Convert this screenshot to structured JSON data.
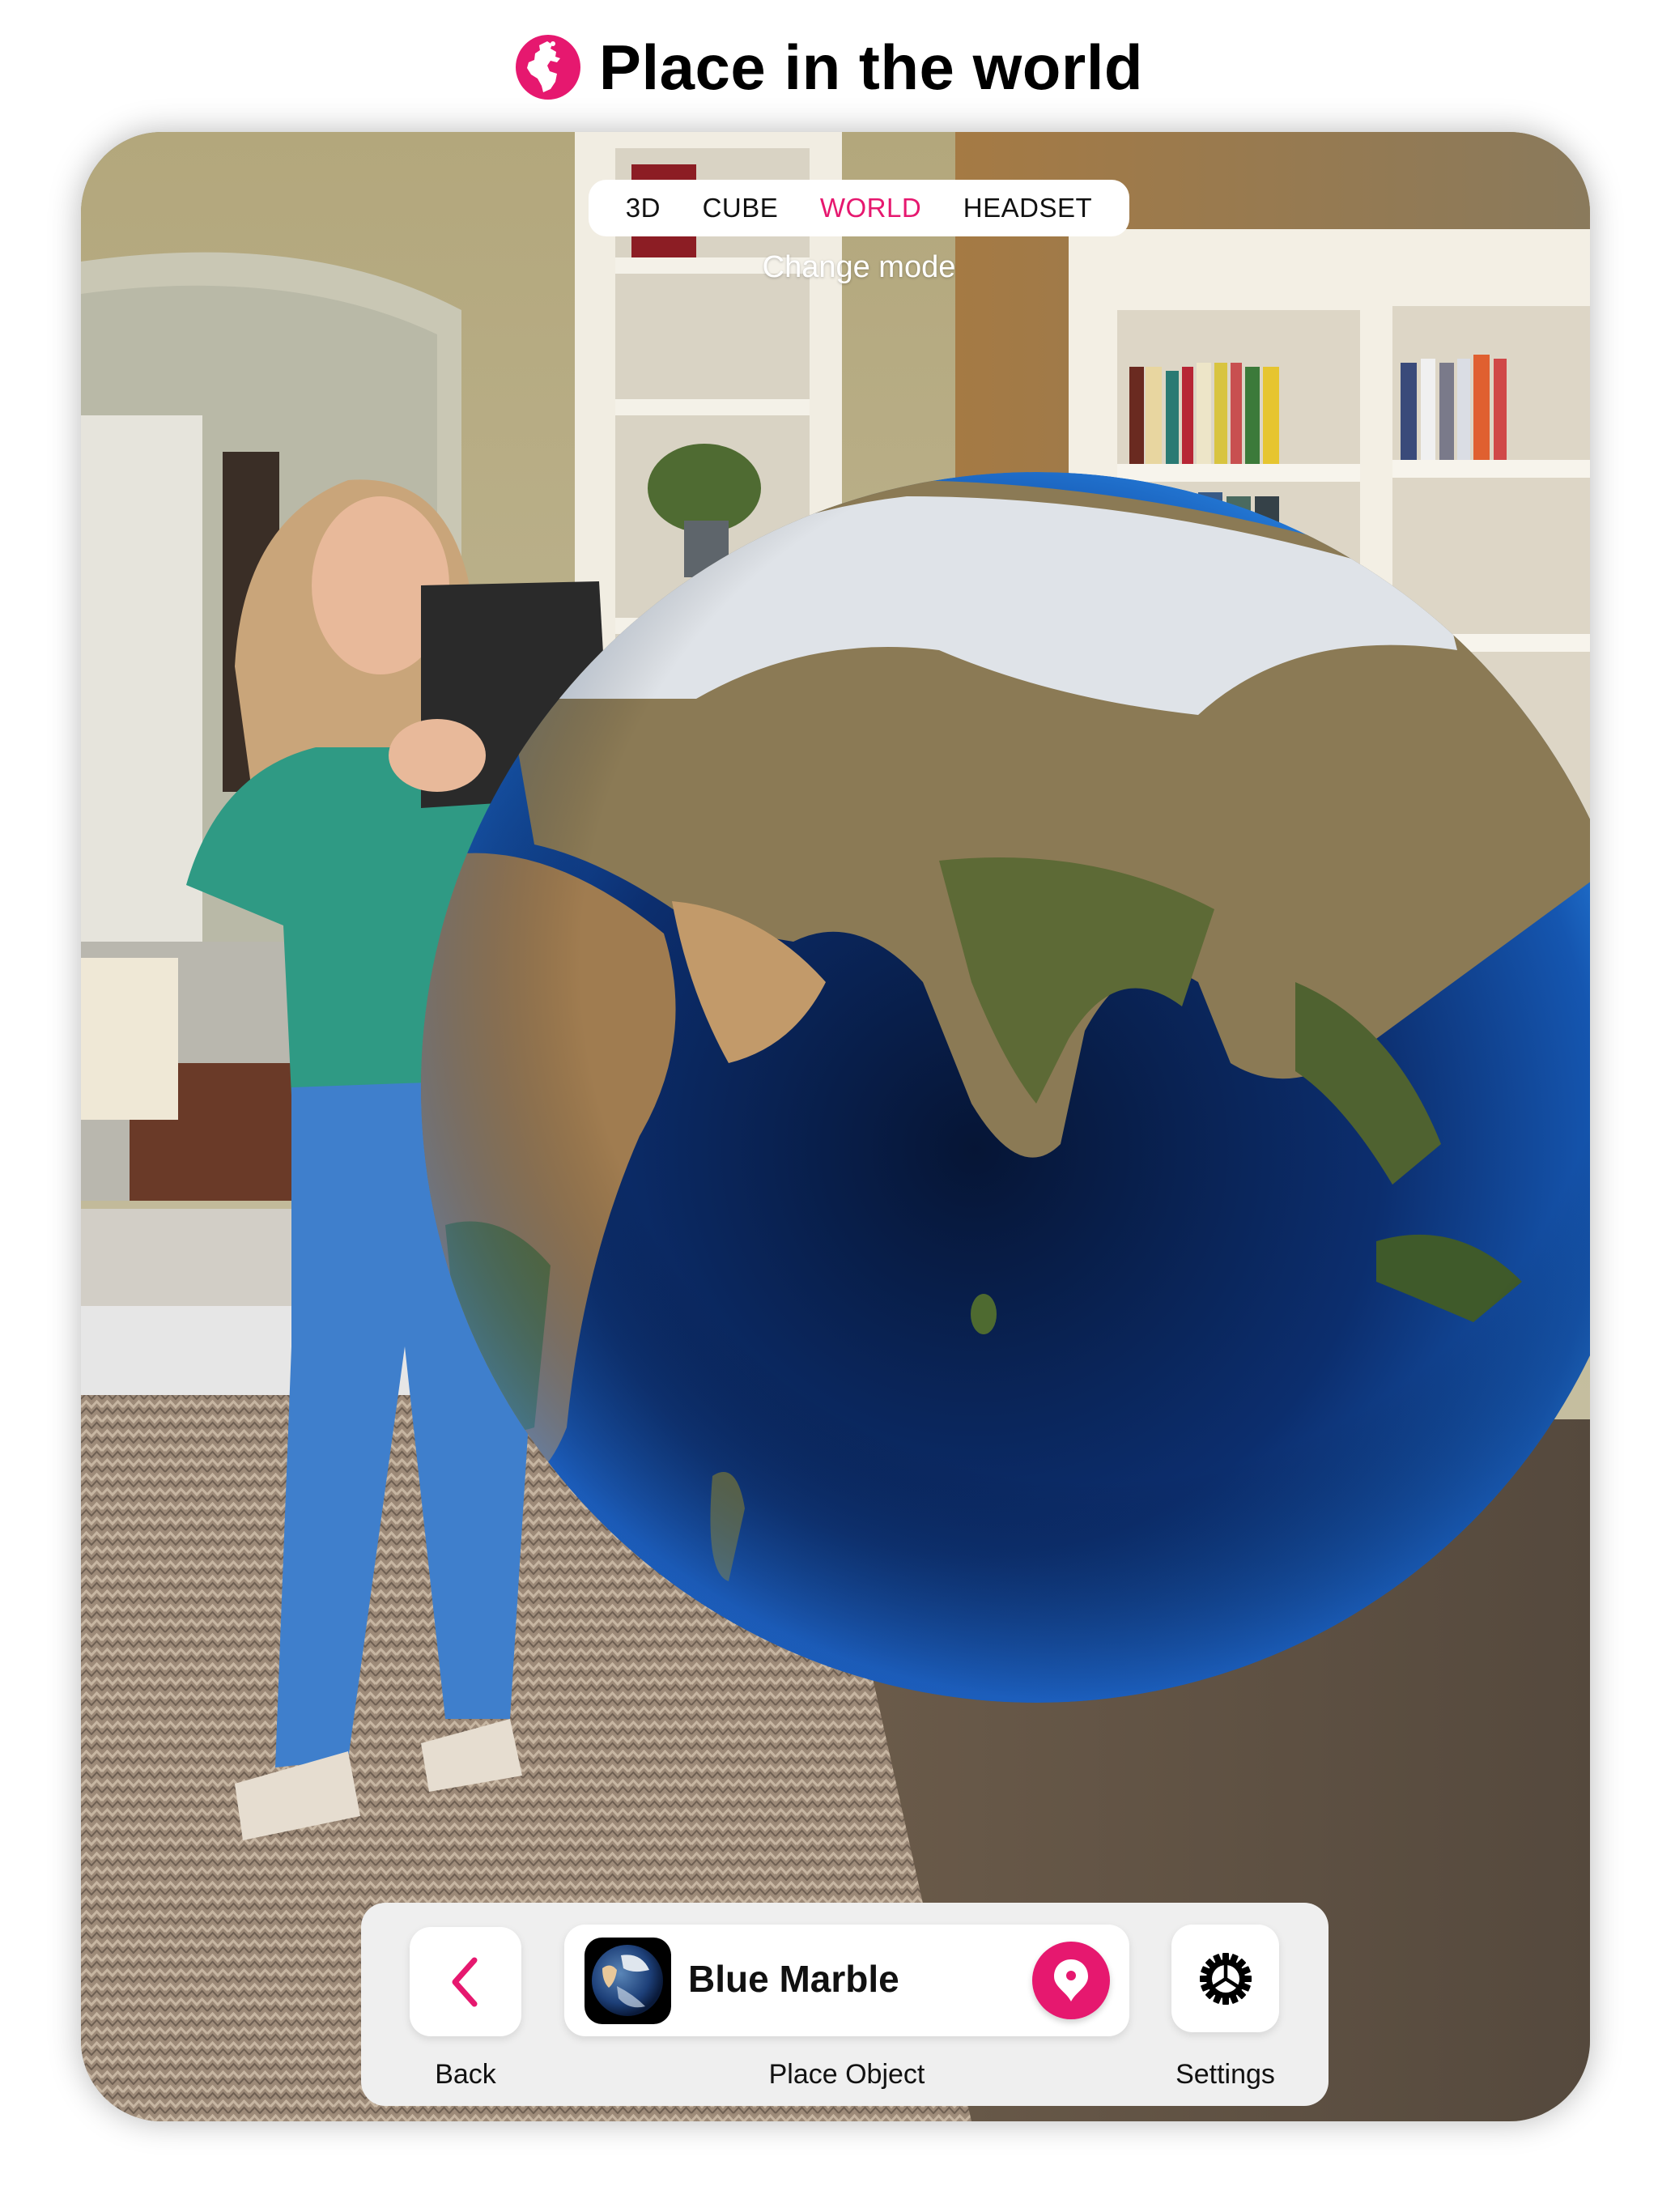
{
  "header": {
    "title": "Place in the world",
    "icon": "globe-icon",
    "accent_color": "#E6186F"
  },
  "ar_view": {
    "scene_description": "Girl holding a tablet in a living room with bookshelves; a large 3D Earth globe placed in AR",
    "mode_selector": {
      "tabs": [
        {
          "label": "3D",
          "active": false
        },
        {
          "label": "CUBE",
          "active": false
        },
        {
          "label": "WORLD",
          "active": true
        },
        {
          "label": "HEADSET",
          "active": false
        }
      ],
      "caption": "Change mode"
    }
  },
  "toolbar": {
    "back": {
      "label": "Back",
      "icon": "chevron-left-icon"
    },
    "object": {
      "name": "Blue Marble",
      "thumbnail": "earth-thumbnail",
      "action_icon": "map-pin-icon",
      "label": "Place Object"
    },
    "settings": {
      "label": "Settings",
      "icon": "gear-icon"
    }
  }
}
